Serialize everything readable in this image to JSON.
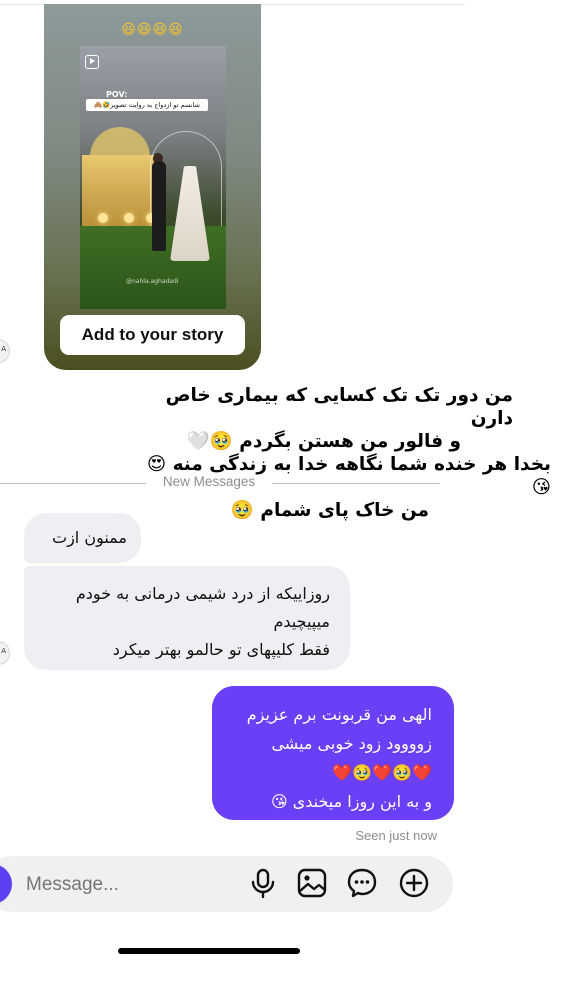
{
  "story": {
    "top_emojis": "😆😆😆😆",
    "pov_label": "POV:",
    "caption": "شانسم تو ازدواج به روایت تصویر🤣🙈",
    "watermark": "@nahla.aghadadi",
    "add_to_story_label": "Add to your story"
  },
  "overlay_text": {
    "line1": "من دور تک تک کسایی که بیماری خاص دارن",
    "line2": "و فالور من هستن بگردم 🥹🤍",
    "line3": "بخدا هر خنده شما نگاهه خدا به زندگی منه 😍😘",
    "line4": "من خاک پای شمام 🥹"
  },
  "divider": {
    "label": "New Messages"
  },
  "messages": {
    "incoming_1": "ممنون ازت",
    "incoming_2_line1": "روزاییکه از درد شیمی درمانی به خودم",
    "incoming_2_line2": "میپیچیدم",
    "incoming_2_line3": "فقط کلیپهای تو حالمو بهتر میکرد",
    "outgoing_1_line1": "الهی من قربونت برم عزیزم",
    "outgoing_1_line2": "زوووود زود خوبی میشی",
    "outgoing_1_line3": "❤️🥹❤️🥹❤️",
    "outgoing_1_line4": "و به این روزا میخندی 😘"
  },
  "seen_status": "Seen just now",
  "composer": {
    "placeholder": "Message...",
    "icons": [
      "microphone-icon",
      "gallery-icon",
      "sticker-icon",
      "add-icon"
    ]
  },
  "colors": {
    "outgoing_bubble": "#6a3ff5",
    "incoming_bubble": "#efeff3",
    "accent": "#5b3ff0"
  }
}
